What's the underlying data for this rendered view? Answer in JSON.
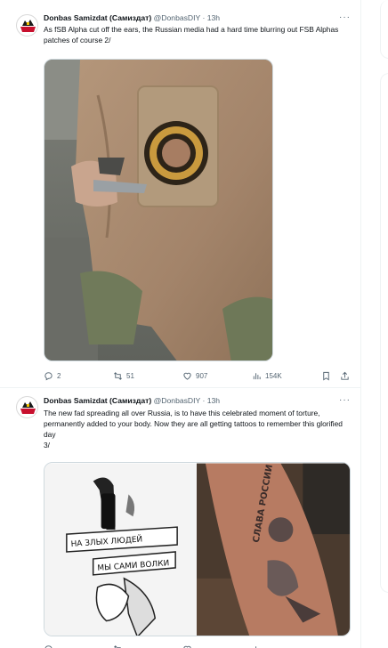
{
  "tweets": [
    {
      "author": "Donbas Samizdat (Самиздат)",
      "handle": "@DonbasDIY",
      "separator": "·",
      "time": "13h",
      "more": "···",
      "text": "As fSB Alpha cut off the ears, the Russian media had a hard time blurring out FSB Alphas patches of course 2/",
      "replies": "2",
      "reposts": "51",
      "likes": "907",
      "views": "154K"
    },
    {
      "author": "Donbas Samizdat (Самиздат)",
      "handle": "@DonbasDIY",
      "separator": "·",
      "time": "13h",
      "more": "···",
      "text": "The new fad spreading all over Russia, is to have this celebrated moment of torture, permanently added to your body.  Now they are all getting tattoos to remember this glorified day",
      "text_suffix": "3/",
      "tattoo_banner_top": "НА ЗЛЫХ ЛЮДЕЙ",
      "tattoo_banner_bottom": "МЫ САМИ ВОЛКИ",
      "arm_tattoo_text": "СЛАВА РОССИИ"
    }
  ],
  "colors": {
    "text_primary": "#0f1419",
    "text_secondary": "#536471",
    "border": "#eff3f4",
    "jacket": "#a88a6c",
    "patch": "#b29a7c"
  }
}
